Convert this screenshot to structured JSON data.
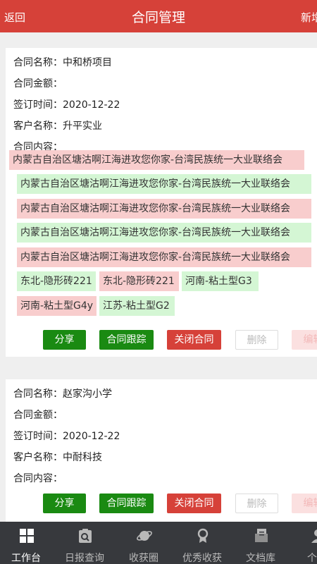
{
  "header": {
    "back": "返回",
    "title": "合同管理",
    "new": "新增"
  },
  "colors": {
    "accent": "#d64139",
    "green": "#1a8a12",
    "tag_red": "#f8cdcd",
    "tag_green": "#d4f6d4",
    "tabbar": "#37393d"
  },
  "labels": {
    "name": "合同名称：",
    "amount": "合同金额：",
    "signed": "签订时间：",
    "customer": "客户名称：",
    "content": "合同内容："
  },
  "contracts": [
    {
      "name": "中和桥项目",
      "amount": "",
      "signed": "2020-12-22",
      "customer": "升平实业",
      "items": [
        "内蒙古自治区塘沽啊江海进攻您你家-台湾民族统一大业联络会",
        "内蒙古自治区塘沽啊江海进攻您你家-台湾民族统一大业联络会",
        "内蒙古自治区塘沽啊江海进攻您你家-台湾民族统一大业联络会",
        "内蒙古自治区塘沽啊江海进攻您你家-台湾民族统一大业联络会",
        "内蒙古自治区塘沽啊江海进攻您你家-台湾民族统一大业联络会",
        "东北-隐形砖221",
        "东北-隐形砖221",
        "河南-粘土型G3",
        "河南-粘土型G4y",
        "江苏-粘土型G2"
      ]
    },
    {
      "name": "赵家沟小学",
      "amount": "",
      "signed": "2020-12-22",
      "customer": "中耐科技",
      "items": []
    }
  ],
  "actions": {
    "share": "分享",
    "track": "合同跟踪",
    "close": "关闭合同",
    "delete": "删除",
    "edit": "编辑"
  },
  "tabs": [
    {
      "label": "工作台",
      "icon": "grid-icon"
    },
    {
      "label": "日报查询",
      "icon": "report-search-icon"
    },
    {
      "label": "收获圈",
      "icon": "planet-icon"
    },
    {
      "label": "优秀收获",
      "icon": "medal-icon"
    },
    {
      "label": "文档库",
      "icon": "document-library-icon"
    },
    {
      "label": "个人",
      "icon": "person-icon"
    }
  ]
}
